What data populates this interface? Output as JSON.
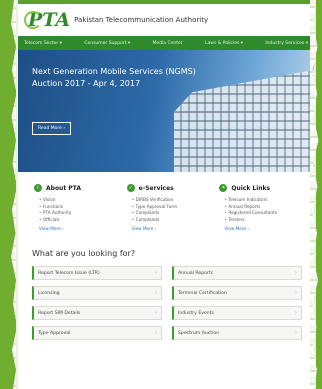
{
  "header": {
    "logo_text": "PTA",
    "org_name": "Pakistan Telecommunication Authority"
  },
  "nav": {
    "items": [
      {
        "label": "Telecom Sector ▾"
      },
      {
        "label": "Consumer Support ▾"
      },
      {
        "label": "Media Center"
      },
      {
        "label": "Laws & Policies ▾"
      },
      {
        "label": "Industry Services ▾"
      }
    ]
  },
  "hero": {
    "title": "Next Generation Mobile Services (NGMS) Auction 2017 - Apr 4, 2017",
    "button_label": "Read More ›"
  },
  "cards": [
    {
      "title": "About PTA",
      "icon": "info-icon",
      "items": [
        "Vision",
        "Functions",
        "PTA Authority",
        "Officials"
      ],
      "link": "View More ›"
    },
    {
      "title": "e-Services",
      "icon": "check-icon",
      "items": [
        "DIRBS Verification",
        "Type Approval Form",
        "Complaints",
        "Complaints"
      ],
      "link": "View More ›"
    },
    {
      "title": "Quick Links",
      "icon": "link-icon",
      "items": [
        "Telecom Indicators",
        "Annual Reports",
        "Registered Consultants",
        "Tenders"
      ],
      "link": "View More ›"
    }
  ],
  "lookup": {
    "title": "What are you looking for?",
    "items": [
      {
        "label": "Report Telecom Issue (LTR)"
      },
      {
        "label": "Annual Reports"
      },
      {
        "label": "Licensing"
      },
      {
        "label": "Terminal Certification"
      },
      {
        "label": "Report SIM Details"
      },
      {
        "label": "Industry Events"
      },
      {
        "label": "Type Approval"
      },
      {
        "label": "Spectrum Auction"
      }
    ]
  }
}
